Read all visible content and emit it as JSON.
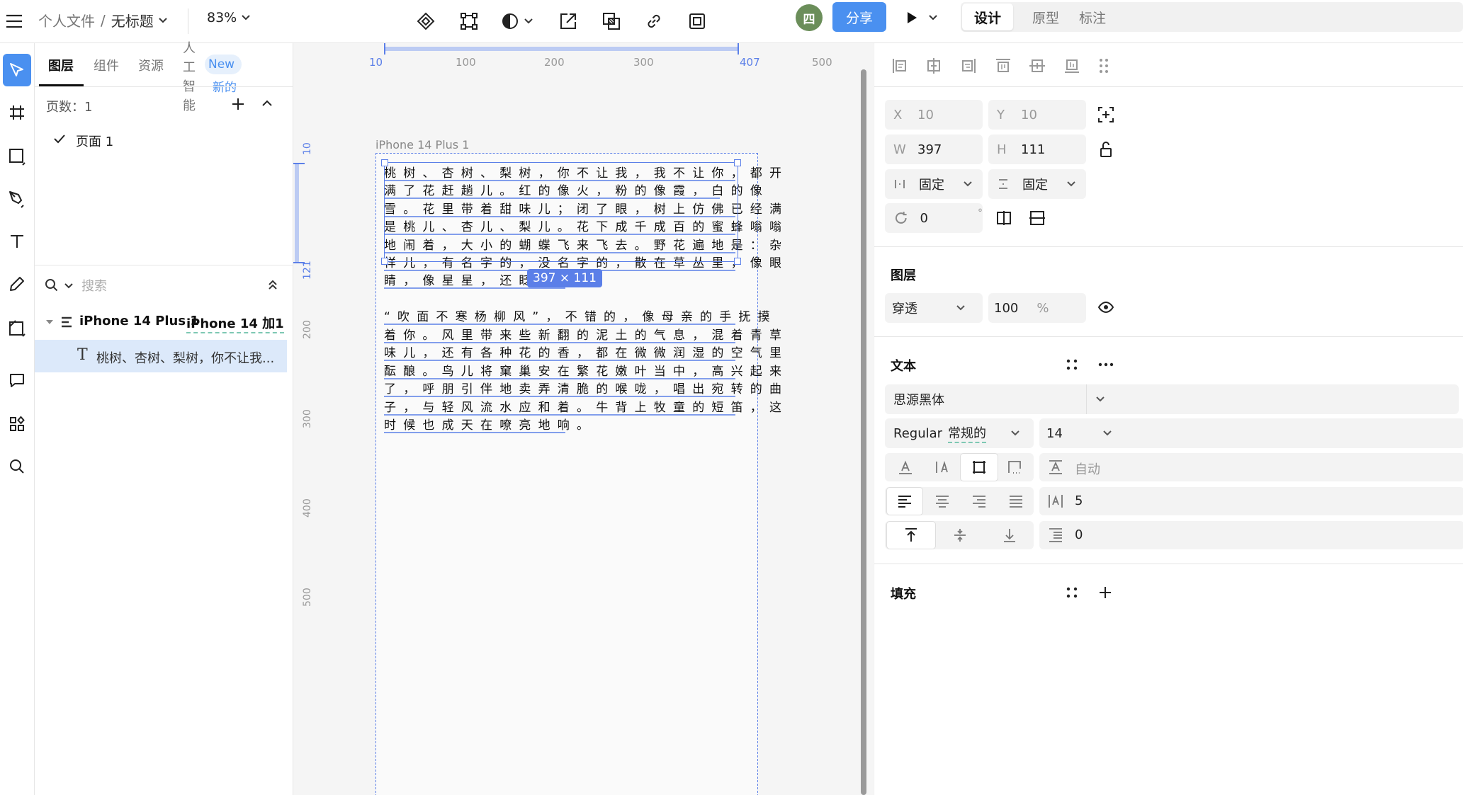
{
  "topbar": {
    "breadcrumb_root": "个人文件",
    "breadcrumb_sep": "/",
    "file_name": "无标题",
    "zoom": "83%",
    "avatar_initial": "四",
    "share_label": "分享",
    "mode_tabs": [
      "设计",
      "原型",
      "标注"
    ]
  },
  "layers_panel": {
    "tabs": [
      "图层",
      "组件",
      "资源"
    ],
    "ai_tab": "人工智能",
    "new_badge": "New",
    "new_badge_cn": "新的",
    "pages_label": "页数：1",
    "pages": [
      "页面 1"
    ],
    "search_placeholder": "搜索",
    "frame_name": "iPhone 14 Plus 1",
    "frame_name_cn": "iPhone 14 加1",
    "text_layer": "桃树、杏树、梨树，你不让我..."
  },
  "canvas": {
    "ruler_top": [
      "10",
      "100",
      "200",
      "300",
      "407",
      "500"
    ],
    "ruler_left": [
      "10",
      "121",
      "200",
      "300",
      "400",
      "500"
    ],
    "frame_label": "iPhone 14 Plus 1",
    "size_badge": "397 × 111",
    "paragraph1": [
      "桃树、杏树、梨树，你不让我，我不让你，都开",
      "满了花赶趟儿。红的像火，粉的像霞，白的像",
      "雪。花里带着甜味儿；闭了眼，树上仿佛已经满",
      "是桃儿、杏儿、梨儿。花下成千成百的蜜蜂嗡嗡",
      "地闹着，大小的蝴蝶飞来飞去。野花遍地是：杂",
      "样儿，有名字的，没名字的，散在草丛里，像眼",
      "睛，像星星，还眨呀眨的。"
    ],
    "paragraph2": [
      "“吹面不寒杨柳风”，不错的，像母亲的手抚摸",
      "着你。风里带来些新翻的泥土的气息，混着青草",
      "味儿，还有各种花的香，都在微微润湿的空气里",
      "酝酿。鸟儿将窠巢安在繁花嫩叶当中，高兴起来",
      "了，呼朋引伴地卖弄清脆的喉咙，唱出宛转的曲",
      "子，与轻风流水应和着。牛背上牧童的短笛，这",
      "时候也成天在嘹亮地响。"
    ]
  },
  "properties": {
    "x_label": "X",
    "x_value": "10",
    "y_label": "Y",
    "y_value": "10",
    "w_label": "W",
    "w_value": "397",
    "h_label": "H",
    "h_value": "111",
    "width_mode": "固定",
    "height_mode": "固定",
    "rotation": "0",
    "degree": "°",
    "layer_section": "图层",
    "blend_mode": "穿透",
    "opacity": "100",
    "percent": "%",
    "text_section": "文本",
    "font_family": "思源黑体",
    "font_weight": "Regular",
    "font_weight_cn": "常规的",
    "font_size": "14",
    "line_height": "自动",
    "letter_spacing": "5",
    "paragraph_spacing": "0",
    "fill_section": "填充"
  },
  "colors": {
    "accent": "#4A90F0",
    "selection": "#5B7FE8",
    "avatar_bg": "#6B8E5A",
    "layer_selected_bg": "#DCE9FA"
  }
}
